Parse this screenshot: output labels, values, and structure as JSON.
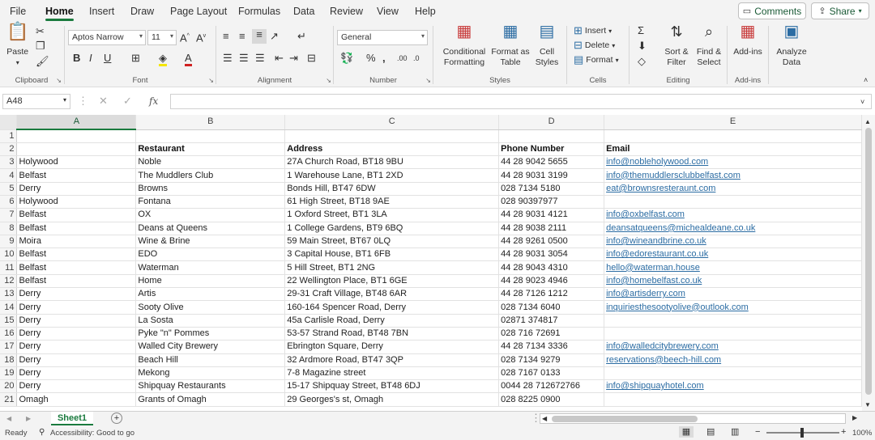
{
  "menu": {
    "tabs": [
      "File",
      "Home",
      "Insert",
      "Draw",
      "Page Layout",
      "Formulas",
      "Data",
      "Review",
      "View",
      "Help"
    ],
    "active": "Home"
  },
  "topright": {
    "comments": "Comments",
    "share": "Share"
  },
  "ribbon": {
    "clipboard": {
      "paste": "Paste",
      "label": "Clipboard"
    },
    "font": {
      "name": "Aptos Narrow",
      "size": "11",
      "label": "Font"
    },
    "alignment": {
      "label": "Alignment"
    },
    "number": {
      "format": "General",
      "label": "Number"
    },
    "styles": {
      "conditional": "Conditional Formatting",
      "format_table": "Format as Table",
      "cell_styles": "Cell Styles",
      "label": "Styles"
    },
    "cells": {
      "insert": "Insert",
      "delete": "Delete",
      "format": "Format",
      "label": "Cells"
    },
    "editing": {
      "sort": "Sort & Filter",
      "find": "Find & Select",
      "label": "Editing"
    },
    "addins": {
      "addins": "Add-ins",
      "label": "Add-ins"
    },
    "analyze": {
      "label": "Analyze Data"
    }
  },
  "formula_bar": {
    "name_box": "A48",
    "fx": "fx",
    "value": ""
  },
  "columns": [
    "A",
    "B",
    "C",
    "D",
    "E"
  ],
  "rows": [
    {
      "n": "1",
      "a": "",
      "b": "",
      "c": "",
      "d": "",
      "e": ""
    },
    {
      "n": "2",
      "a": "",
      "b": "Restaurant",
      "c": "Address",
      "d": "Phone Number",
      "e": "Email"
    },
    {
      "n": "3",
      "a": "Holywood",
      "b": "Noble",
      "c": "27A Church Road, BT18 9BU",
      "d": "44 28 9042 5655",
      "e": "info@nobleholywood.com"
    },
    {
      "n": "4",
      "a": "Belfast",
      "b": "The Muddlers Club",
      "c": "1 Warehouse Lane, BT1 2XD",
      "d": "44 28 9031 3199",
      "e": "info@themuddlersclubbelfast.com"
    },
    {
      "n": "5",
      "a": "Derry",
      "b": "Browns",
      "c": "Bonds Hill, BT47 6DW",
      "d": "028 7134 5180",
      "e": "eat@brownsresteraunt.com"
    },
    {
      "n": "6",
      "a": "Holywood",
      "b": "Fontana",
      "c": "61 High Street, BT18 9AE",
      "d": "028 90397977",
      "e": ""
    },
    {
      "n": "7",
      "a": "Belfast",
      "b": "OX",
      "c": "1 Oxford Street, BT1 3LA",
      "d": "44 28 9031 4121",
      "e": "info@oxbelfast.com"
    },
    {
      "n": "8",
      "a": "Belfast",
      "b": "Deans at Queens",
      "c": "1 College Gardens, BT9 6BQ",
      "d": "44 28 9038 2111",
      "e": "deansatqueens@michealdeane.co.uk"
    },
    {
      "n": "9",
      "a": "Moira",
      "b": "Wine & Brine",
      "c": "59 Main Street, BT67 0LQ",
      "d": "44 28 9261 0500",
      "e": "info@wineandbrine.co.uk"
    },
    {
      "n": "10",
      "a": "Belfast",
      "b": "EDO",
      "c": "3 Capital House, BT1 6FB",
      "d": "44 28 9031 3054",
      "e": "info@edorestaurant.co.uk"
    },
    {
      "n": "11",
      "a": "Belfast",
      "b": "Waterman",
      "c": "5 Hill Street, BT1 2NG",
      "d": "44 28 9043 4310",
      "e": "hello@waterman.house"
    },
    {
      "n": "12",
      "a": "Belfast",
      "b": "Home",
      "c": "22 Wellington Place, BT1 6GE",
      "d": "44 28 9023 4946",
      "e": "info@homebelfast.co.uk"
    },
    {
      "n": "13",
      "a": "Derry",
      "b": "Artis",
      "c": "29-31 Craft Village, BT48 6AR",
      "d": "44 28 7126 1212",
      "e": "info@artisderry.com"
    },
    {
      "n": "14",
      "a": "Derry",
      "b": "Sooty Olive",
      "c": "160-164 Spencer Road, Derry",
      "d": "028 7134 6040",
      "e": "inquiriesthesootyolive@outlook.com"
    },
    {
      "n": "15",
      "a": "Derry",
      "b": "La Sosta",
      "c": "45a Carlisle Road, Derry",
      "d": "02871 374817",
      "e": ""
    },
    {
      "n": "16",
      "a": "Derry",
      "b": "Pyke \"n\" Pommes",
      "c": "53-57 Strand Road, BT48 7BN",
      "d": "028 716 72691",
      "e": ""
    },
    {
      "n": "17",
      "a": "Derry",
      "b": "Walled City Brewery",
      "c": "Ebrington Square, Derry",
      "d": "44 28 7134 3336",
      "e": "info@walledcitybrewery.com"
    },
    {
      "n": "18",
      "a": "Derry",
      "b": "Beach Hill",
      "c": "32 Ardmore Road, BT47 3QP",
      "d": "028 7134 9279",
      "e": "reservations@beech-hill.com"
    },
    {
      "n": "19",
      "a": "Derry",
      "b": "Mekong",
      "c": "7-8 Magazine street",
      "d": "028 7167 0133",
      "e": ""
    },
    {
      "n": "20",
      "a": "Derry",
      "b": "Shipquay Restaurants",
      "c": "15-17 Shipquay Street, BT48 6DJ",
      "d": "0044 28 712672766",
      "e": "info@shipquayhotel.com"
    },
    {
      "n": "21",
      "a": "Omagh",
      "b": "Grants of Omagh",
      "c": "29 Georges's st, Omagh",
      "d": "028 8225 0900",
      "e": ""
    }
  ],
  "sheet_tab": "Sheet1",
  "status": {
    "ready": "Ready",
    "accessibility": "Accessibility: Good to go",
    "zoom": "100%"
  },
  "colors": {
    "accent": "#1a7a3e",
    "link": "#2b6ca3"
  }
}
